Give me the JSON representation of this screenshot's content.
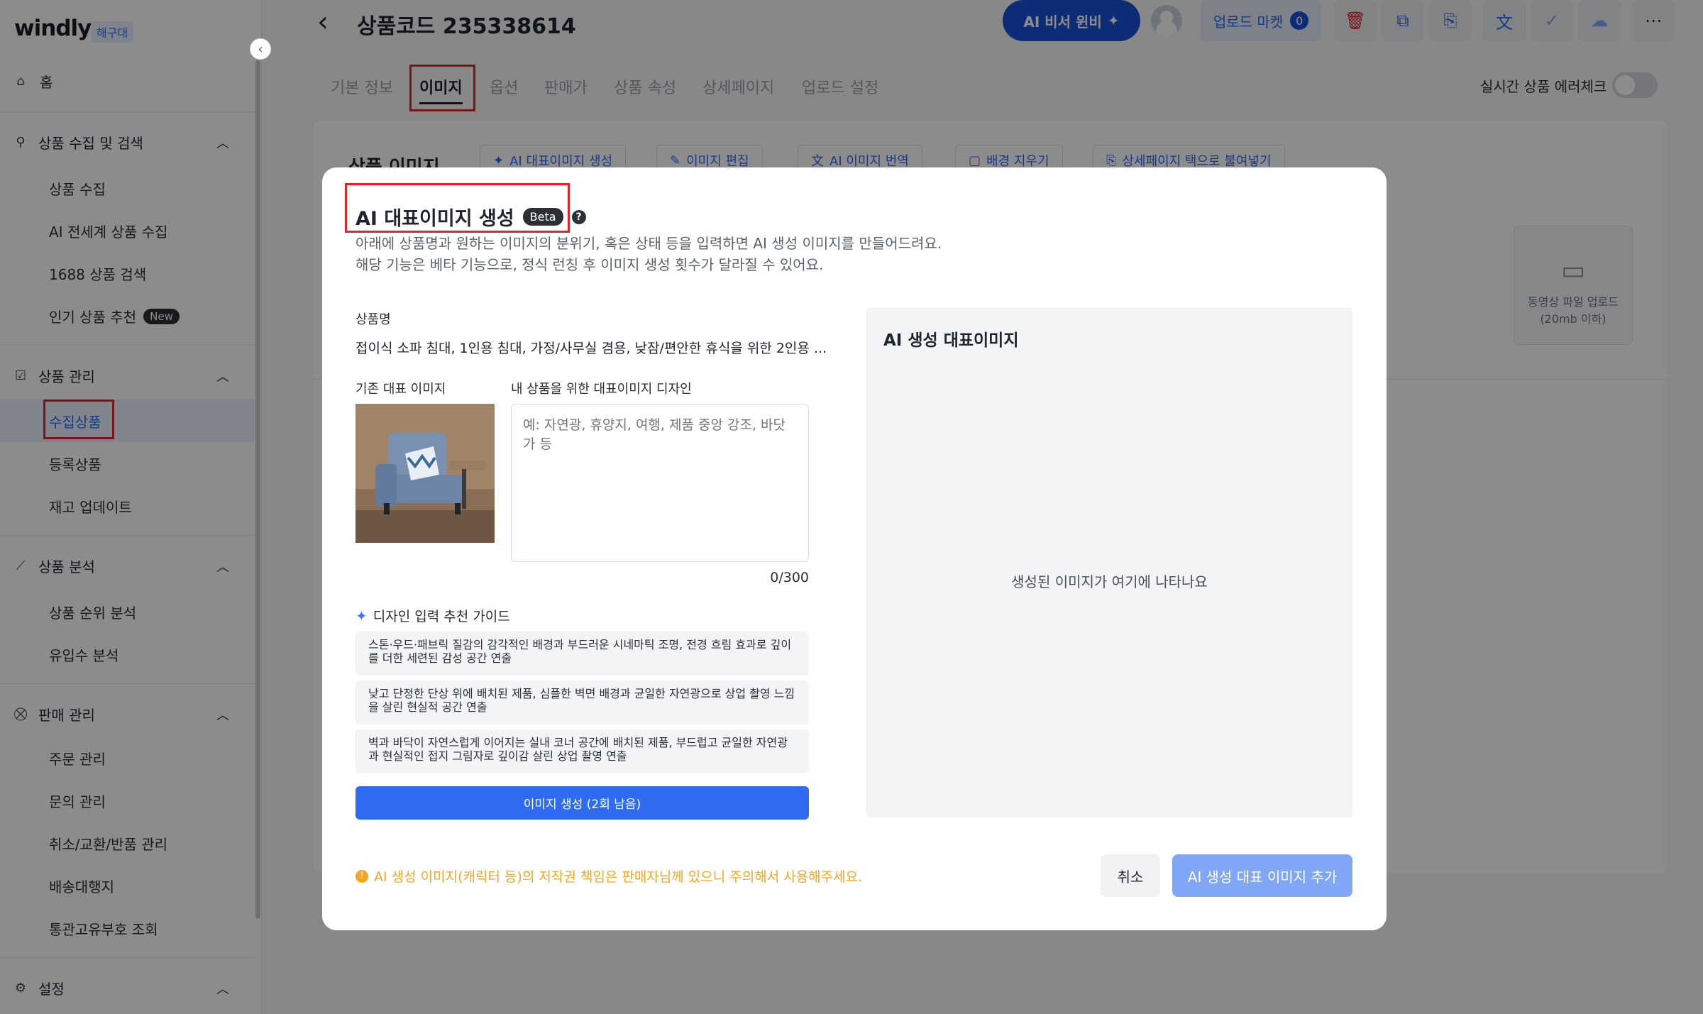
{
  "sidebar": {
    "logo": "windly",
    "logo_badge": "해구대",
    "home": "홈",
    "groups": [
      {
        "label": "상품 수집 및 검색",
        "items": [
          "상품 수집",
          "AI 전세계 상품 수집",
          "1688 상품 검색",
          "인기 상품 추천"
        ]
      },
      {
        "label": "상품 관리",
        "items": [
          "수집상품",
          "등록상품",
          "재고 업데이트"
        ]
      },
      {
        "label": "상품 분석",
        "items": [
          "상품 순위 분석",
          "유입수 분석"
        ]
      },
      {
        "label": "판매 관리",
        "items": [
          "주문 관리",
          "문의 관리",
          "취소/교환/반품 관리",
          "배송대행지",
          "통관고유부호 조회"
        ]
      },
      {
        "label": "설정",
        "items": []
      }
    ],
    "new_badge": "New"
  },
  "header": {
    "title": "상품코드 235338614",
    "ai_button": "AI 비서 윈비",
    "upload_market": "업로드 마켓",
    "upload_count": "0"
  },
  "tabs": [
    "기본 정보",
    "이미지",
    "옵션",
    "판매가",
    "상품 속성",
    "상세페이지",
    "업로드 설정"
  ],
  "realtime_check": "실시간 상품 에러체크",
  "background": {
    "card_title": "상품 이미지",
    "toolbar": [
      "AI 대표이미지 생성",
      "이미지 편집",
      "AI 이미지 번역",
      "배경 지우기",
      "상세페이지 택으로 불여넣기"
    ],
    "video_upload": [
      "동영상 파일 업로드",
      "(20mb 이하)"
    ]
  },
  "modal": {
    "title": "AI 대표이미지 생성",
    "beta": "Beta",
    "desc_line1": "아래에 상품명과 원하는 이미지의 분위기, 혹은 상태 등을 입력하면 AI 생성 이미지를 만들어드려요.",
    "desc_line2": "해당 기능은 베타 기능으로, 정식 런칭 후 이미지 생성 횟수가 달라질 수 있어요.",
    "product_name_label": "상품명",
    "product_name": "접이식 소파 침대, 1인용 침대, 가정/사무실 겸용, 낮잠/편안한 휴식을 위한 2인용 ...",
    "existing_image_label": "기존 대표 이미지",
    "design_label": "내 상품을 위한 대표이미지 디자인",
    "design_placeholder": "예: 자연광, 휴양지, 여행, 제품 중앙 강조, 바닷가 등",
    "counter": "0/300",
    "guide_title": "디자인 입력 추천 가이드",
    "guides": [
      "스톤·우드·패브릭 질감의 감각적인 배경과 부드러운 시네마틱 조명, 전경 흐림 효과로 깊이를 더한 세련된 감성 공간 연출",
      "낮고 단정한 단상 위에 배치된 제품, 심플한 벽면 배경과 균일한 자연광으로 상업 촬영 느낌을 살린 현실적 공간 연출",
      "벽과 바닥이 자연스럽게 이어지는 실내 코너 공간에 배치된 제품, 부드럽고 균일한 자연광과 현실적인 접지 그림자로 깊이감 살린 상업 촬영 연출"
    ],
    "generate_button": "이미지 생성 (2회 남음)",
    "right_title": "AI 생성 대표이미지",
    "right_empty": "생성된 이미지가 여기에 나타나요",
    "warning": "AI 생성 이미지(캐릭터 등)의 저작권 책임은 판매자님께 있으니 주의해서 사용해주세요.",
    "cancel": "취소",
    "add": "AI 생성 대표 이미지 추가"
  }
}
